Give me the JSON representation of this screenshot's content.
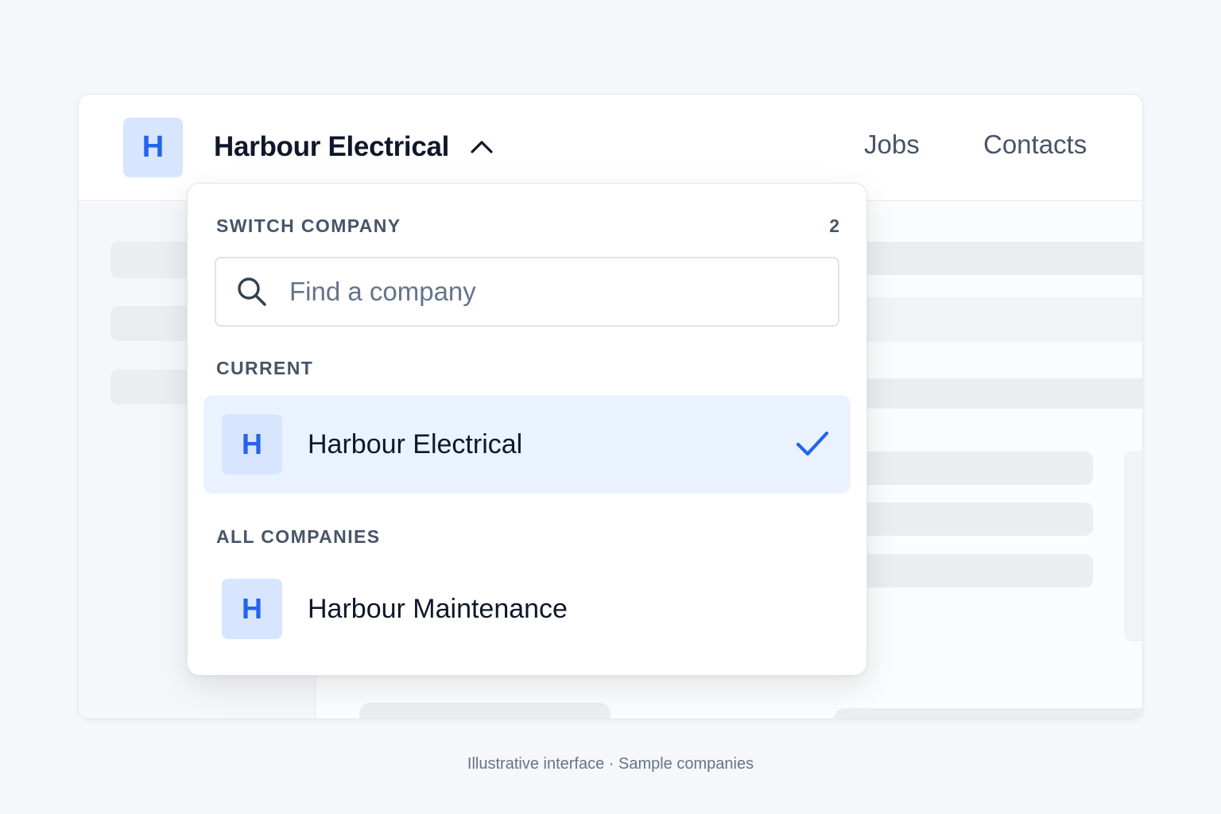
{
  "header": {
    "avatar_letter": "H",
    "company_name": "Harbour Electrical",
    "nav": [
      "Jobs",
      "Contacts"
    ]
  },
  "dropdown": {
    "title": "SWITCH COMPANY",
    "count": "2",
    "search": {
      "placeholder": "Find a company",
      "value": ""
    },
    "current_label": "CURRENT",
    "current": {
      "avatar_letter": "H",
      "name": "Harbour Electrical",
      "selected": true
    },
    "all_label": "ALL COMPANIES",
    "companies": [
      {
        "avatar_letter": "H",
        "name": "Harbour Maintenance"
      }
    ]
  },
  "caption": "Illustrative interface · Sample companies",
  "icons": {
    "chevron": "chevron-up-icon",
    "search": "search-icon",
    "check": "check-icon"
  },
  "colors": {
    "accent": "#2563eb",
    "avatar_bg": "#d7e5ff",
    "selected_row_bg": "#eaf2ff",
    "text_primary": "#0f172a",
    "text_muted": "#475569"
  }
}
